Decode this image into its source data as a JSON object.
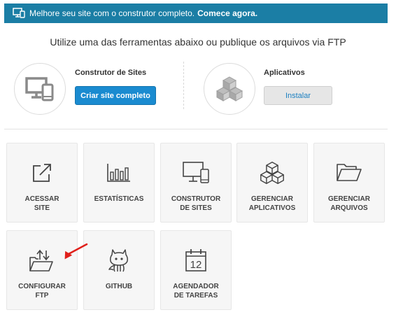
{
  "banner": {
    "text": "Melhore seu site com o construtor completo.",
    "link": "Comece agora."
  },
  "subtitle": "Utilize uma das ferramentas abaixo ou publique os arquivos via FTP",
  "builder": {
    "title": "Construtor de Sites",
    "button": "Criar site completo",
    "icon": "monitor-devices-icon"
  },
  "apps": {
    "title": "Aplicativos",
    "button": "Instalar",
    "icon": "cubes-icon"
  },
  "tiles": [
    {
      "label": "ACESSAR\nSITE",
      "icon": "external-link-icon"
    },
    {
      "label": "ESTATÍSTICAS",
      "icon": "bar-chart-icon"
    },
    {
      "label": "CONSTRUTOR\nDE SITES",
      "icon": "monitor-phone-icon"
    },
    {
      "label": "GERENCIAR\nAPLICATIVOS",
      "icon": "cubes-icon"
    },
    {
      "label": "GERENCIAR\nARQUIVOS",
      "icon": "folder-icon"
    },
    {
      "label": "CONFIGURAR\nFTP",
      "icon": "folder-transfer-icon"
    },
    {
      "label": "GITHUB",
      "icon": "github-octocat-icon"
    },
    {
      "label": "AGENDADOR\nDE TAREFAS",
      "icon": "calendar-icon"
    }
  ],
  "calendar_day": "12",
  "colors": {
    "banner": "#1b7ea5",
    "primary_button": "#1a8bd0",
    "annotation_arrow": "#e0201b"
  }
}
